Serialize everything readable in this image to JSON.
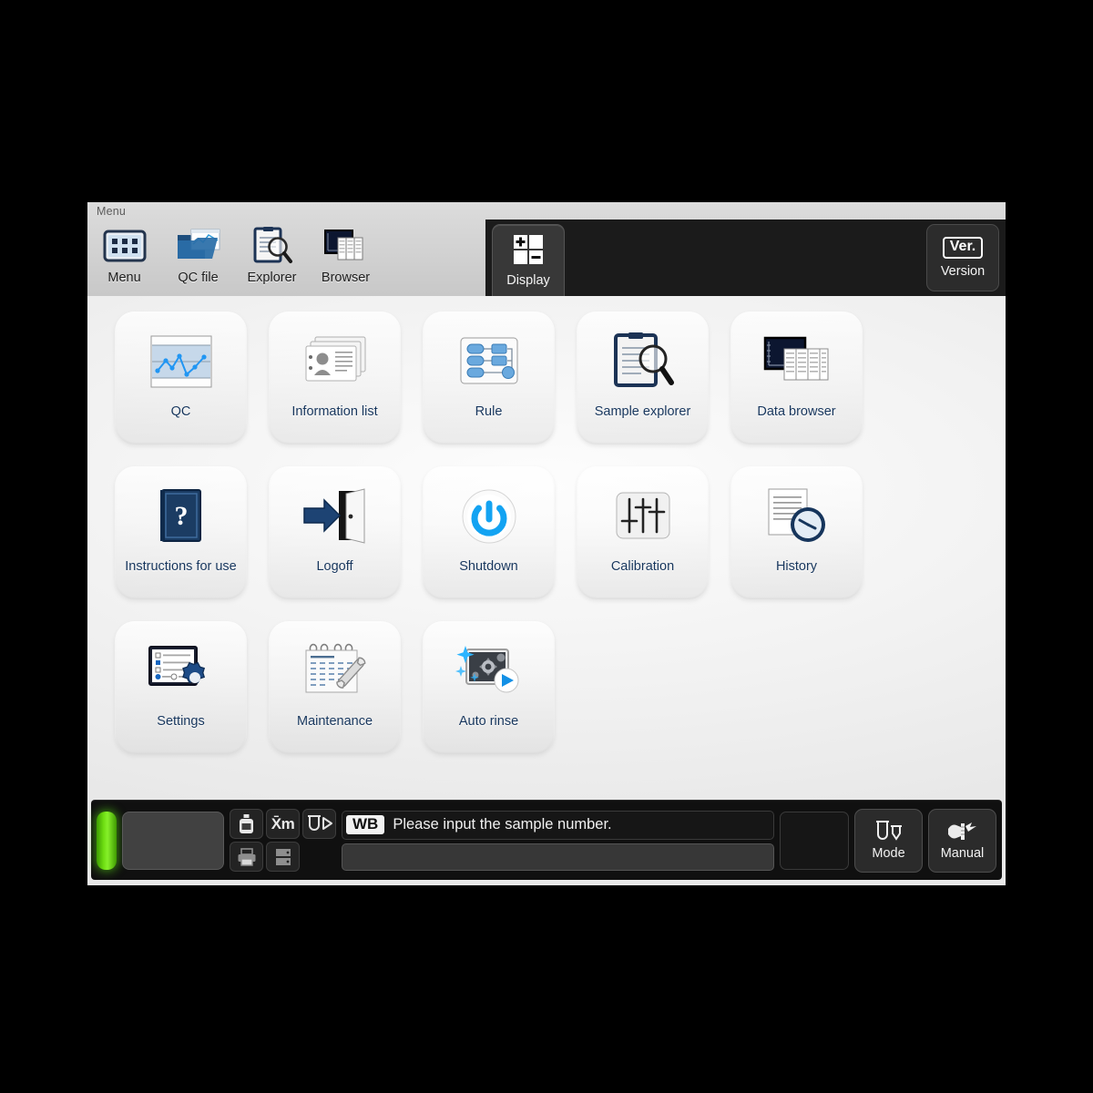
{
  "window": {
    "caption": "Menu"
  },
  "toolbar": {
    "items": [
      {
        "label": "Menu",
        "icon": "menu-grid-icon"
      },
      {
        "label": "QC file",
        "icon": "qc-file-folder-icon"
      },
      {
        "label": "Explorer",
        "icon": "clipboard-magnifier-icon"
      },
      {
        "label": "Browser",
        "icon": "data-browser-icon"
      }
    ],
    "active_tab": {
      "label": "Display",
      "icon": "display-quad-icon"
    },
    "version_button": {
      "label": "Version",
      "badge": "Ver.",
      "icon": "version-badge-icon"
    }
  },
  "menu_grid": {
    "rows": [
      [
        {
          "label": "QC",
          "icon": "qc-chart-icon"
        },
        {
          "label": "Information list",
          "icon": "information-list-icon"
        },
        {
          "label": "Rule",
          "icon": "rule-flowchart-icon"
        },
        {
          "label": "Sample explorer",
          "icon": "sample-explorer-icon"
        },
        {
          "label": "Data browser",
          "icon": "data-browser-icon"
        }
      ],
      [
        {
          "label": "Instructions for use",
          "icon": "manual-book-icon"
        },
        {
          "label": "Logoff",
          "icon": "logoff-door-icon"
        },
        {
          "label": "Shutdown",
          "icon": "power-icon"
        },
        {
          "label": "Calibration",
          "icon": "sliders-icon"
        },
        {
          "label": "History",
          "icon": "history-clock-icon"
        }
      ],
      [
        {
          "label": "Settings",
          "icon": "settings-gear-icon"
        },
        {
          "label": "Maintenance",
          "icon": "maintenance-wrench-icon"
        },
        {
          "label": "Auto rinse",
          "icon": "auto-rinse-icon"
        }
      ]
    ]
  },
  "status_bar": {
    "lamp_color": "#6ede12",
    "mini_buttons": [
      {
        "name": "reagent-bottle-icon"
      },
      {
        "name": "mean-xm-icon",
        "text": "X̄m"
      },
      {
        "name": "tube-feed-icon"
      },
      {
        "name": "printer-icon"
      },
      {
        "name": "host-server-icon"
      }
    ],
    "message_badge": "WB",
    "message": "Please input the sample number.",
    "sample_input_value": "",
    "sample_input_placeholder": "",
    "buttons": [
      {
        "label": "Mode",
        "icon": "tube-mode-icon"
      },
      {
        "label": "Manual",
        "icon": "manual-hand-tube-icon"
      }
    ]
  },
  "colors": {
    "desktop": "#000000",
    "window_bg": "#e8e8e8",
    "tile_label": "#17365d",
    "dark_panel": "#1b1b1b",
    "status_bar": "#101010"
  }
}
